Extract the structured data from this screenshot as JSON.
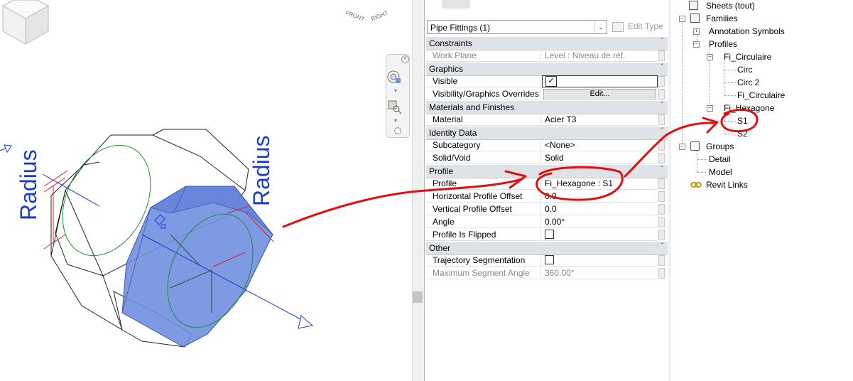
{
  "viewport": {
    "dimension_labels": [
      "Radius",
      "Radius"
    ],
    "viewcube": {
      "front": "FRONT",
      "right": "RIGHT"
    }
  },
  "properties": {
    "type_selector": "Pipe Fittings (1)",
    "edit_type": "Edit Type",
    "categories": [
      {
        "name": "Constraints",
        "rows": [
          {
            "name": "Work Plane",
            "value": "Level : Niveau de réf.",
            "disabled": true
          }
        ]
      },
      {
        "name": "Graphics",
        "rows": [
          {
            "name": "Visible",
            "value": "",
            "checkbox": true,
            "checked": true
          },
          {
            "name": "Visibility/Graphics Overrides",
            "value": "Edit...",
            "button": true
          }
        ]
      },
      {
        "name": "Materials and Finishes",
        "rows": [
          {
            "name": "Material",
            "value": "Acier T3"
          }
        ]
      },
      {
        "name": "Identity Data",
        "rows": [
          {
            "name": "Subcategory",
            "value": "<None>"
          },
          {
            "name": "Solid/Void",
            "value": "Solid"
          }
        ]
      },
      {
        "name": "Profile",
        "rows": [
          {
            "name": "Profile",
            "value": "Fi_Hexagone : S1"
          },
          {
            "name": "Horizontal Profile Offset",
            "value": "0.0"
          },
          {
            "name": "Vertical Profile Offset",
            "value": "0.0"
          },
          {
            "name": "Angle",
            "value": "0.00°"
          },
          {
            "name": "Profile Is Flipped",
            "value": "",
            "checkbox": true,
            "checked": false
          }
        ]
      },
      {
        "name": "Other",
        "rows": [
          {
            "name": "Trajectory Segmentation",
            "value": "",
            "checkbox": true,
            "checked": false
          },
          {
            "name": "Maximum Segment Angle",
            "value": "360.00°",
            "disabled": true
          }
        ]
      }
    ]
  },
  "browser": {
    "sheets": "Sheets (tout)",
    "families": "Families",
    "annotation_symbols": "Annotation Symbols",
    "profiles": "Profiles",
    "fi_circulaire": "Fi_Circulaire",
    "circ": "Circ",
    "circ2": "Circ 2",
    "fi_circulaire_type": "Fi_Circulaire",
    "fi_hexagone": "Fi_Hexagone",
    "s1": "S1",
    "s2": "S2",
    "groups": "Groups",
    "detail": "Detail",
    "model": "Model",
    "revit_links": "Revit Links"
  },
  "colors": {
    "selection_fill": "#6f8fe0",
    "annotation_red": "#e01010",
    "dimension_blue": "#1a3cd1"
  }
}
